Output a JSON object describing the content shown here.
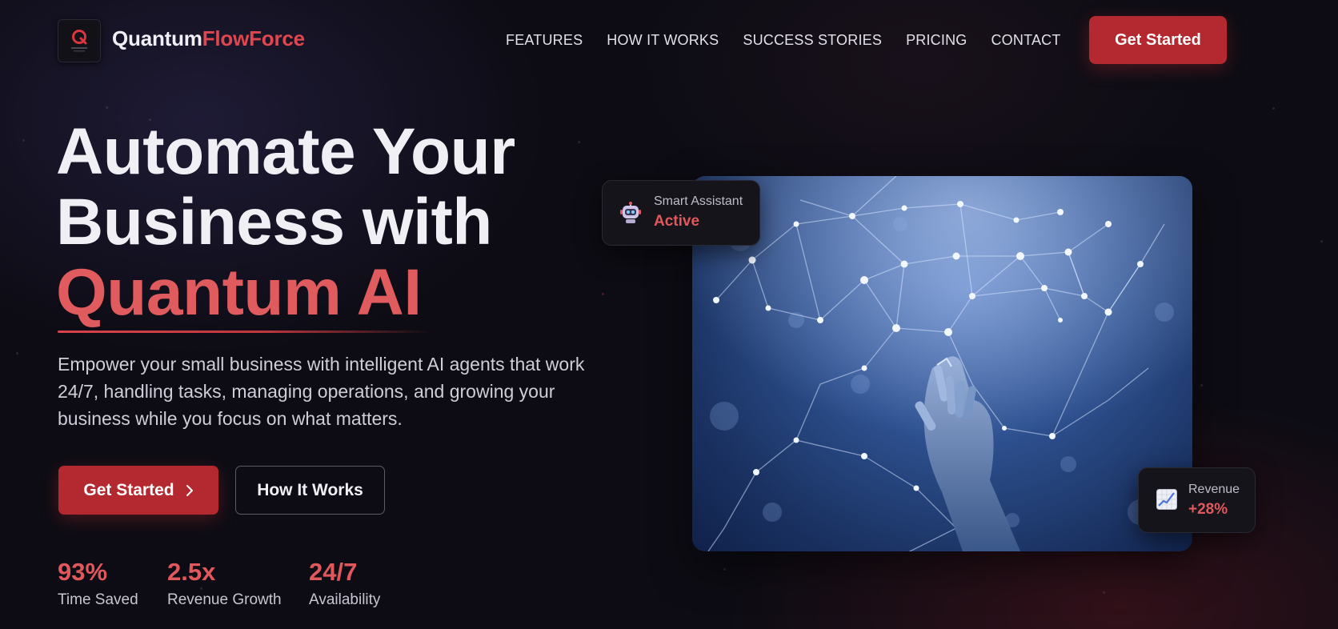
{
  "brand": {
    "name_part1": "Quantum",
    "name_part2": "FlowForce",
    "logo_icon": "quantum-q-logo"
  },
  "nav": {
    "items": [
      "FEATURES",
      "HOW IT WORKS",
      "SUCCESS STORIES",
      "PRICING",
      "CONTACT"
    ],
    "cta_label": "Get Started"
  },
  "hero": {
    "title_line1": "Automate Your",
    "title_line2": "Business with",
    "title_line3": "Quantum AI",
    "description": "Empower your small business with intelligent AI agents that work 24/7, handling tasks, managing operations, and growing your business while you focus on what matters.",
    "primary_button": "Get Started",
    "primary_button_icon": "chevron-right-icon",
    "secondary_button": "How It Works"
  },
  "stats": [
    {
      "value": "93%",
      "label": "Time Saved"
    },
    {
      "value": "2.5x",
      "label": "Revenue Growth"
    },
    {
      "value": "24/7",
      "label": "Availability"
    }
  ],
  "cards": {
    "assistant": {
      "icon": "robot-icon",
      "label": "Smart Assistant",
      "value": "Active"
    },
    "revenue": {
      "icon": "chart-increasing-icon",
      "label": "Revenue",
      "value": "+28%"
    }
  },
  "colors": {
    "accent": "#e0585b",
    "button": "#b4282f",
    "background": "#0d0c14"
  }
}
